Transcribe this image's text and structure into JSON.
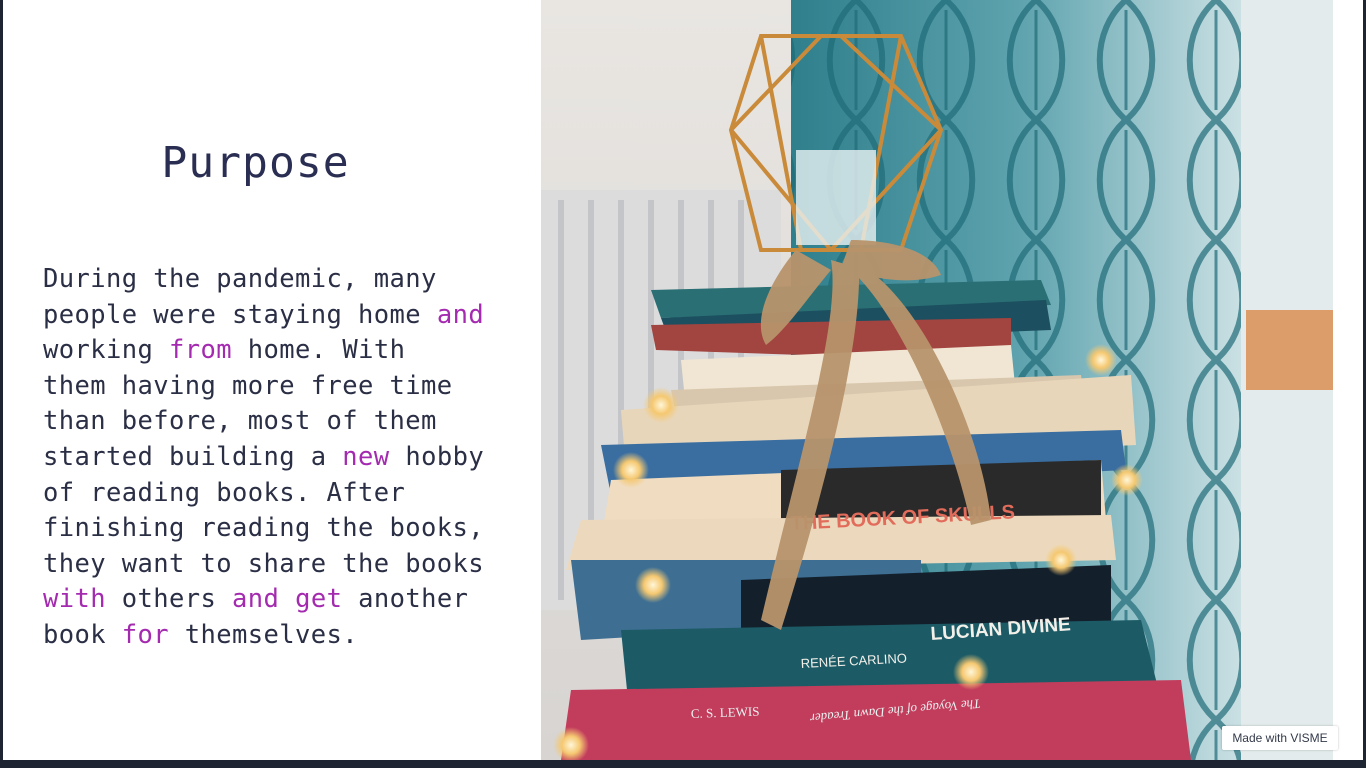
{
  "slide": {
    "title": "Purpose",
    "body_lines": [
      [
        {
          "t": "During the pandemic, many",
          "hl": false
        }
      ],
      [
        {
          "t": "people were staying home ",
          "hl": false
        },
        {
          "t": "and",
          "hl": true
        }
      ],
      [
        {
          "t": "working ",
          "hl": false
        },
        {
          "t": "from",
          "hl": true
        },
        {
          "t": " home. With",
          "hl": false
        }
      ],
      [
        {
          "t": "them having more free time",
          "hl": false
        }
      ],
      [
        {
          "t": "than before, most of them",
          "hl": false
        }
      ],
      [
        {
          "t": "started building a ",
          "hl": false
        },
        {
          "t": "new",
          "hl": true
        },
        {
          "t": " hobby",
          "hl": false
        }
      ],
      [
        {
          "t": "of reading books. After",
          "hl": false
        }
      ],
      [
        {
          "t": "finishing reading the books,",
          "hl": false
        }
      ],
      [
        {
          "t": "they want to share the books",
          "hl": false
        }
      ],
      [
        {
          "t": "with",
          "hl": true
        },
        {
          "t": " others ",
          "hl": false
        },
        {
          "t": "and",
          "hl": true
        },
        {
          "t": " ",
          "hl": false
        },
        {
          "t": "get",
          "hl": true
        },
        {
          "t": " another",
          "hl": false
        }
      ],
      [
        {
          "t": "book ",
          "hl": false
        },
        {
          "t": "for",
          "hl": true
        },
        {
          "t": " themselves.",
          "hl": false
        }
      ]
    ],
    "highlight_color": "#a42bb0",
    "text_color": "#2b2f45",
    "title_color": "#2a2e52"
  },
  "photo": {
    "book_spine_text_1": "THE BOOK OF SKULLS",
    "book_spine_text_2": "LUCIAN DIVINE",
    "book_spine_text_3": "RENÉE CARLINO",
    "book_spine_text_4": "C. S. LEWIS",
    "book_spine_text_5": "The Voyage of the Dawn Treader"
  },
  "watermark": {
    "label": "Made with VISME"
  }
}
